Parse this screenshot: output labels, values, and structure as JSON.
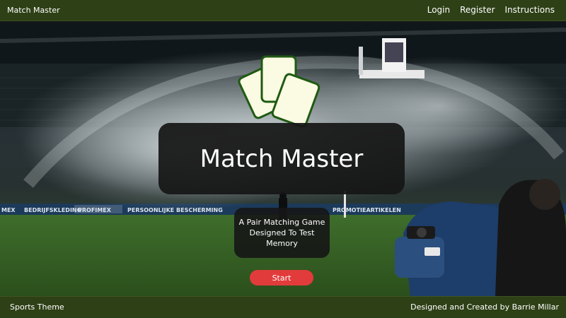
{
  "header": {
    "brand": "Match Master",
    "nav": [
      {
        "label": "Login"
      },
      {
        "label": "Register"
      },
      {
        "label": "Instructions"
      }
    ]
  },
  "hero": {
    "title": "Match Master",
    "subtitle": "A Pair Matching Game Designed To Test Memory",
    "start_label": "Start",
    "banner_texts": [
      "BEDRIJFSKLEDING",
      "PROFIMEX",
      "PERSOONLIJKE BESCHERMING",
      "PROMOTIEARTIKELEN"
    ]
  },
  "footer": {
    "left": "Sports Theme",
    "right": "Designed and Created by Barrie Millar"
  },
  "colors": {
    "nav_bg": "#2e4016",
    "start_button": "#e23b3b",
    "card_fill": "#fbfbe3",
    "card_border": "#1f5a12"
  }
}
